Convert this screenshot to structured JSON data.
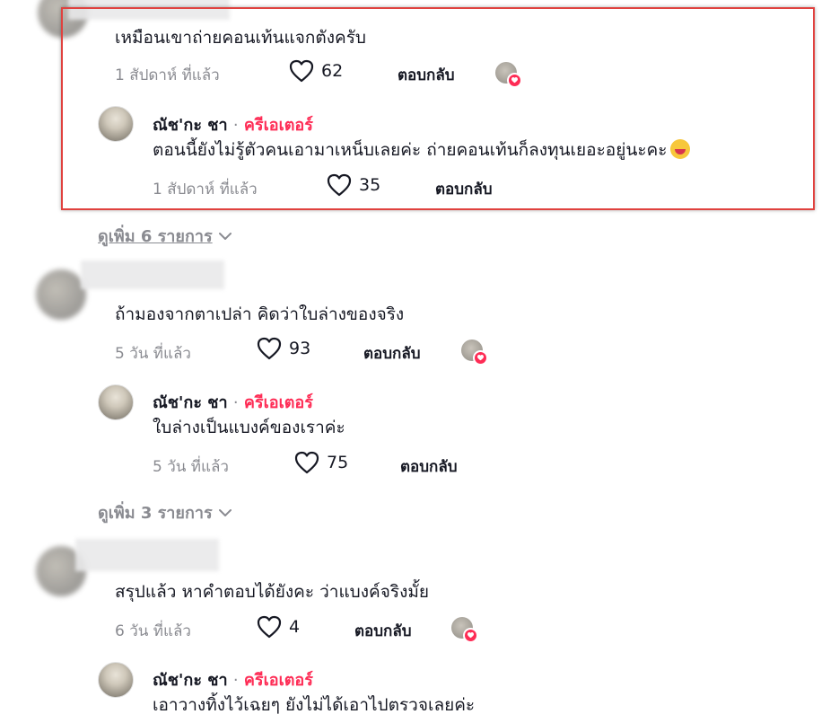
{
  "colors": {
    "accent": "#fe2c55",
    "muted": "#8a8b91",
    "text": "#161823",
    "highlight_border": "#e0413e"
  },
  "icons": {
    "like": "heart-outline-icon",
    "expand": "chevron-down-icon",
    "creator_liked": "heart-badge-icon"
  },
  "threads": [
    {
      "comment": {
        "text": "เหมือนเขาถ่ายคอนเท้นแจกตังครับ",
        "time": "1 สัปดาห์ ที่แล้ว",
        "likes": "62",
        "reply_label": "ตอบกลับ"
      },
      "reply": {
        "author": "ณัช'กะ ชา",
        "separator": "·",
        "role": "ครีเอเตอร์",
        "text": "ตอนนี้ยังไม่รู้ตัวคนเอามาเหน็บเลยค่ะ ถ่ายคอนเท้นก็ลงทุนเยอะอยู่นะคะ",
        "emoji": "grinning-face-emoji",
        "time": "1 สัปดาห์ ที่แล้ว",
        "likes": "35",
        "reply_label": "ตอบกลับ"
      },
      "view_more": "ดูเพิ่ม 6 รายการ"
    },
    {
      "comment": {
        "text": "ถ้ามองจากตาเปล่า คิดว่าใบล่างของจริง",
        "time": "5 วัน ที่แล้ว",
        "likes": "93",
        "reply_label": "ตอบกลับ"
      },
      "reply": {
        "author": "ณัช'กะ ชา",
        "separator": "·",
        "role": "ครีเอเตอร์",
        "text": "ใบล่างเป็นแบงค์ของเราค่ะ",
        "time": "5 วัน ที่แล้ว",
        "likes": "75",
        "reply_label": "ตอบกลับ"
      },
      "view_more": "ดูเพิ่ม 3 รายการ"
    },
    {
      "comment": {
        "text": "สรุปแล้ว หาคำตอบได้ยังคะ ว่าแบงค์จริงมั้ย",
        "time": "6 วัน ที่แล้ว",
        "likes": "4",
        "reply_label": "ตอบกลับ"
      },
      "reply": {
        "author": "ณัช'กะ ชา",
        "separator": "·",
        "role": "ครีเอเตอร์",
        "text": "เอาวางทิ้งไว้เฉยๆ ยังไม่ได้เอาไปตรวจเลยค่ะ"
      }
    }
  ]
}
